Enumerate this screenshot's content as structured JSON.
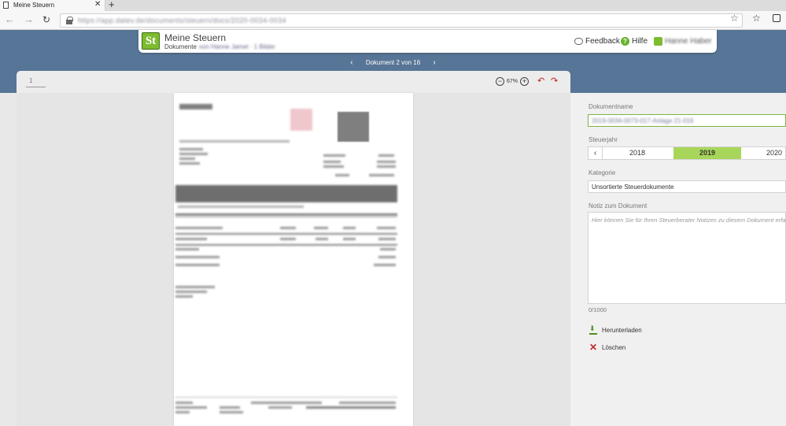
{
  "browser": {
    "tab_title": "Meine Steuern",
    "new_tab": "+",
    "close": "✕",
    "url": "https://app.datev.de/documents/steuern/docs/2020-0034-0034"
  },
  "app": {
    "logo": "St",
    "title": "Meine Steuern",
    "subtitle_prefix": "Dokumente",
    "subtitle_blur": "von Hanne Jamet · 1 Bilder",
    "feedback": "Feedback",
    "help": "Hilfe",
    "user": "Hanne Haber"
  },
  "pager": {
    "label": "Dokument 2 von 16",
    "prev": "‹",
    "next": "›"
  },
  "viewer": {
    "page": "1",
    "zoom": "67%",
    "zoom_out": "−",
    "zoom_in": "+"
  },
  "panel": {
    "doc_name_label": "Dokumentname",
    "doc_name_value": "2019-0034-0073-017-Anlage 21-016",
    "tax_year_label": "Steuerjahr",
    "years": [
      "2018",
      "2019",
      "2020"
    ],
    "selected_year": "2019",
    "year_prev": "‹",
    "category_label": "Kategorie",
    "category_value": "Unsortierte Steuerdokumente",
    "note_label": "Notiz zum Dokument",
    "note_placeholder": "Hier können Sie für Ihren Steuerberater Notizen zu diesem Dokument erfassen.",
    "char_count": "0/1000",
    "download": "Herunterladen",
    "delete": "Löschen"
  }
}
